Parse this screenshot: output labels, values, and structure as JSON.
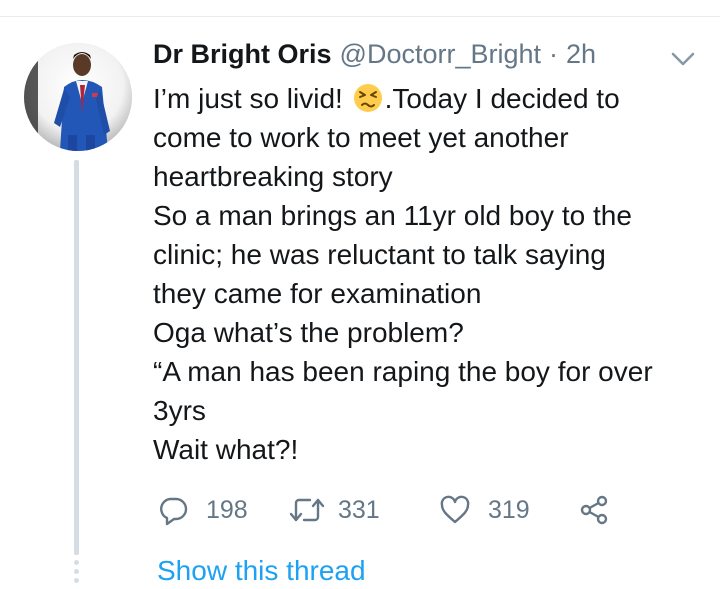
{
  "tweet": {
    "author_name": "Dr Bright Oris",
    "handle": "@Doctorr_Bright",
    "separator": "·",
    "time": "2h",
    "body_lines": [
      {
        "text": "I’m just so livid! ",
        "after_emoji": ".Today I decided to"
      },
      "come to work to meet yet another",
      "heartbreaking story",
      "So a man brings an 11yr old boy to the",
      "clinic; he was reluctant to talk saying",
      "they came for examination",
      "Oga what’s the problem?",
      "“A man has been raping the boy for over",
      "3yrs",
      "Wait what?!"
    ],
    "emoji": "persevering-face",
    "replies": "198",
    "retweets": "331",
    "likes": "319",
    "show_thread_label": "Show this thread"
  },
  "icons": {
    "reply": "reply-icon",
    "retweet": "retweet-icon",
    "like": "heart-icon",
    "share": "share-icon",
    "more": "chevron-down-icon"
  },
  "colors": {
    "text_primary": "#14171a",
    "text_secondary": "#657786",
    "link": "#1da1f2",
    "thread_line": "#d4dde4",
    "emoji_face": "#ffcc4d"
  }
}
